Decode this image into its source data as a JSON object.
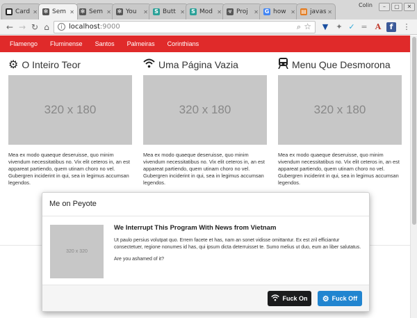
{
  "browser": {
    "tabs": [
      {
        "title": "Card",
        "fav_color": "#222",
        "fav_glyph": "■",
        "active": false
      },
      {
        "title": "Sem",
        "fav_color": "#555",
        "fav_glyph": "✻",
        "active": true
      },
      {
        "title": "Sem",
        "fav_color": "#555",
        "fav_glyph": "✻",
        "active": false
      },
      {
        "title": "You",
        "fav_color": "#555",
        "fav_glyph": "✻",
        "active": false
      },
      {
        "title": "Butt",
        "fav_color": "#2aa198",
        "fav_glyph": "S",
        "active": false
      },
      {
        "title": "Mod",
        "fav_color": "#2aa198",
        "fav_glyph": "S",
        "active": false
      },
      {
        "title": "Proj",
        "fav_color": "#555",
        "fav_glyph": "☣",
        "active": false
      },
      {
        "title": "how",
        "fav_color": "#4285f4",
        "fav_glyph": "G",
        "active": false
      },
      {
        "title": "javas",
        "fav_color": "#e37b1f",
        "fav_glyph": "▤",
        "active": false
      }
    ],
    "user": "Colin",
    "url_host": "localhost",
    "url_port": ":9000"
  },
  "navbar": {
    "items": [
      "Flamengo",
      "Fluminense",
      "Santos",
      "Palmeiras",
      "Corinthians"
    ]
  },
  "columns": [
    {
      "title": "O Inteiro Teor",
      "icon": "gears-icon",
      "glyph": "⚙",
      "placeholder": "320 x 180",
      "text": "Mea ex modo quaeque deseruisse, quo minim vivendum necessitatibus no. Vix elit ceteros in, an est appareat partiendo, quem utinam choro no vel. Gubergren inciderint in qui, sea in legimus accumsan legendos."
    },
    {
      "title": "Uma Página Vazia",
      "icon": "wifi-icon",
      "glyph": "◠",
      "placeholder": "320 x 180",
      "text": "Mea ex modo quaeque deseruisse, quo minim vivendum necessitatibus no. Vix elit ceteros in, an est appareat partiendo, quem utinam choro no vel. Gubergren inciderint in qui, sea in legimus accumsan legendos."
    },
    {
      "title": "Menu Que Desmorona",
      "icon": "train-icon",
      "glyph": "🚆",
      "placeholder": "320 x 180",
      "text": "Mea ex modo quaeque deseruisse, quo minim vivendum necessitatibus no. Vix elit ceteros in, an est appareat partiendo, quem utinam choro no vel. Gubergren inciderint in qui, sea in legimus accumsan legendos."
    }
  ],
  "modal": {
    "header": "Me on Peyote",
    "image_placeholder": "320 x 320",
    "title": "We Interrupt This Program With News from Vietnam",
    "body": "Ut paulo persius volutpat quo. Errem facete et has, nam an sonet vidisse omittantur. Ex est zril efficiantur consectetuer, regione nonumes id has, qui ipsum dicta deterruisset te. Sumo melius ut duo, eum an liber salutatus.",
    "question": "Are you ashamed of it?",
    "buttons": [
      {
        "label": "Fuck On",
        "icon": "wifi-icon",
        "color": "#1b1c1d"
      },
      {
        "label": "Fuck Off",
        "icon": "gears-icon",
        "color": "#2185d0"
      }
    ]
  }
}
